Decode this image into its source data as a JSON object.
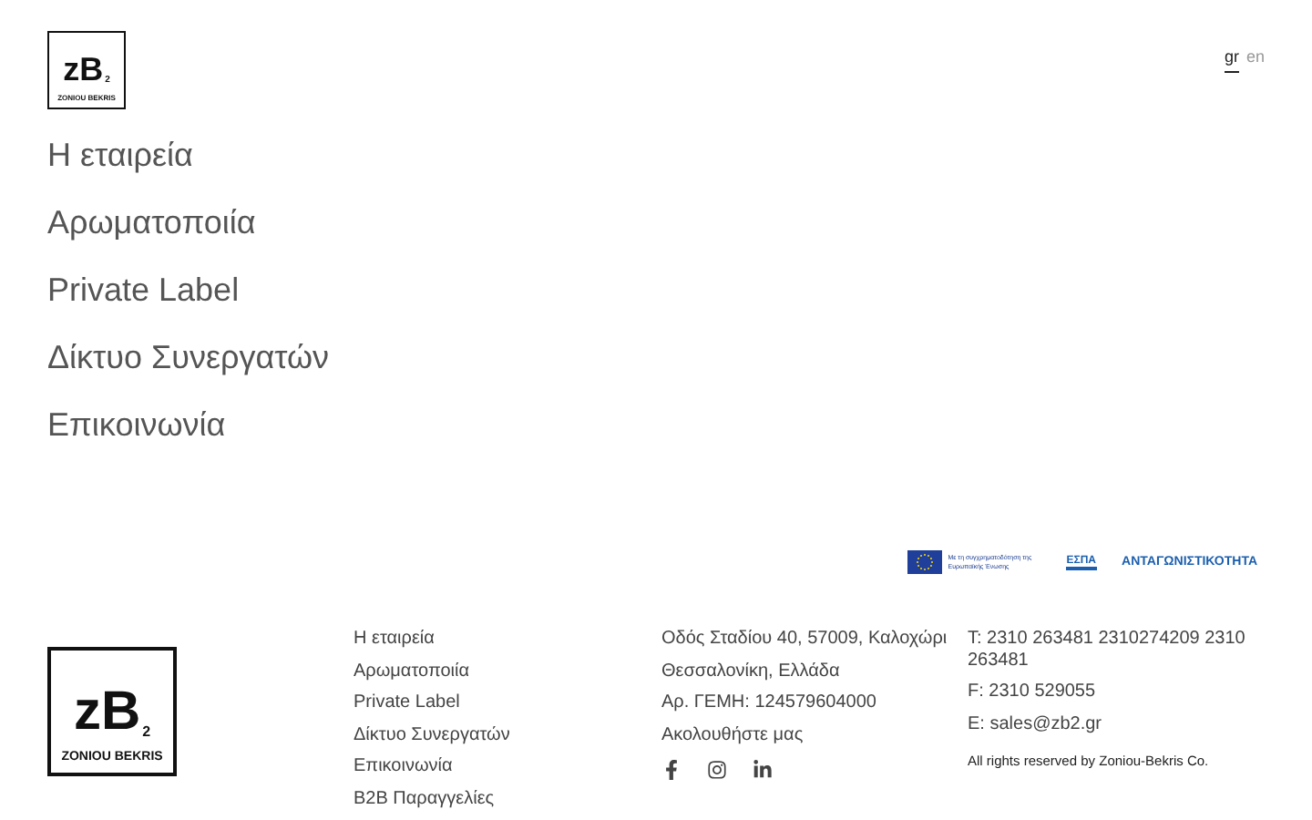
{
  "header": {
    "logo": {
      "main": "zB",
      "sub": "2",
      "caption": "ZONIOU BEKRIS"
    },
    "languages": [
      {
        "label": "gr",
        "selected": true
      },
      {
        "label": "en",
        "selected": false
      }
    ]
  },
  "nav": [
    "Η εταιρεία",
    "Αρωματοποιία",
    "Private Label",
    "Δίκτυο Συνεργατών",
    "Επικοινωνία"
  ],
  "funding_banner": {
    "eu_caption": "Με τη συγχρηματοδότηση της Ευρωπαϊκής Ένωσης",
    "espa": "ΕΣΠΑ",
    "program": "ΑΝΤΑΓΩΝΙΣΤΙΚΟΤΗΤΑ"
  },
  "footer": {
    "logo": {
      "main": "zB",
      "sub": "2",
      "caption": "ZONIOU BEKRIS"
    },
    "links": [
      "Η εταιρεία",
      "Αρωματοποιία",
      "Private Label",
      "Δίκτυο Συνεργατών",
      "Επικοινωνία",
      "B2B Παραγγελίες"
    ],
    "address": [
      "Οδός Σταδίου 40, 57009, Καλοχώρι",
      "Θεσσαλονίκη, Ελλάδα",
      "Αρ. ΓΕΜΗ: 124579604000"
    ],
    "follow": "Ακολουθήστε μας",
    "social": [
      {
        "kind": "facebook"
      },
      {
        "kind": "instagram"
      },
      {
        "kind": "linkedin"
      }
    ],
    "contact": [
      "T: 2310 263481 2310274209 2310 263481",
      "F: 2310 529055",
      "E: sales@zb2.gr"
    ],
    "copyright": "All rights reserved by Zoniou-Bekris Co."
  }
}
